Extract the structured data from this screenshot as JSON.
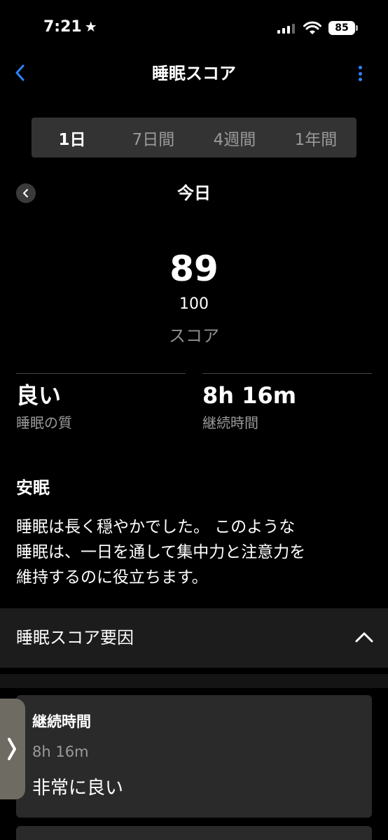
{
  "status_bar": {
    "time": "7:21",
    "star": "★",
    "battery": "85"
  },
  "nav": {
    "title": "睡眠スコア"
  },
  "tabs": [
    {
      "label": "1日",
      "active": true
    },
    {
      "label": "7日間",
      "active": false
    },
    {
      "label": "4週間",
      "active": false
    },
    {
      "label": "1年間",
      "active": false
    }
  ],
  "date_nav": {
    "label": "今日"
  },
  "score": {
    "value": "89",
    "max": "100",
    "label": "スコア"
  },
  "stats": {
    "quality": {
      "value": "良い",
      "label": "睡眠の質"
    },
    "duration": {
      "value": "8h 16m",
      "label": "継続時間"
    }
  },
  "description": {
    "title": "安眠",
    "lines": [
      "睡眠は長く穏やかでした。 このような",
      "睡眠は、一日を通して集中力と注意力を",
      "維持するのに役立ちます。"
    ]
  },
  "factors": {
    "title": "睡眠スコア要因",
    "items": [
      {
        "name": "継続時間",
        "value": "8h 16m",
        "rating": "非常に良い"
      }
    ]
  },
  "colors": {
    "accent": "#2f84ff",
    "background": "#000000",
    "card": "#2a2a2a"
  }
}
